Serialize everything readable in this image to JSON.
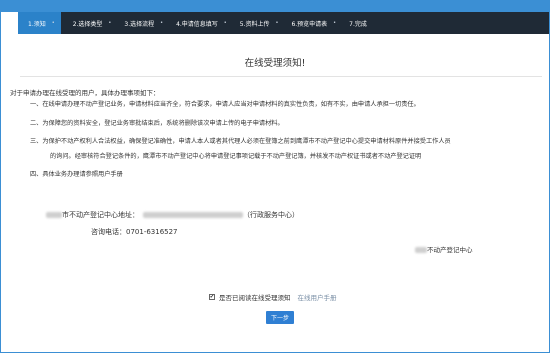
{
  "steps": [
    {
      "label": "1.须知"
    },
    {
      "label": "2.选择类型"
    },
    {
      "label": "3.选择流程"
    },
    {
      "label": "4.申请信息填写"
    },
    {
      "label": "5.资料上传"
    },
    {
      "label": "6.预览申请表"
    },
    {
      "label": "7.完成"
    }
  ],
  "step_separator": "•",
  "page_title": "在线受理须知!",
  "intro": "对于申请办理在线受理的用户，具体办理事项如下：",
  "notes": [
    "一、在线申请办理不动产登记业务，申请材料应当齐全，符合要求，申请人应当对申请材料的真实性负责，如有不实，由申请人承担一切责任。",
    "二、为保障您的资料安全，登记业务审批结束后，系统将删除该次申请上传的电子申请材料。",
    "三、为保护不动产权利人合法权益，确保登记准确性，申请人本人或者其代理人必须在登簿之前到鹰潭市不动产登记中心提交申请材料原件并接受工作人员",
    "的询问。经审核符合登记条件的，鹰潭市不动产登记中心将申请登记事项记载于不动产登记簿，并核发不动产权证书或者不动产登记证明",
    "四、具体业务办理请参照用户手册"
  ],
  "address_label": "市不动产登记中心地址：",
  "address_suffix": "（行政服务中心）",
  "phone_label": "咨询电话：",
  "phone": "0701-6316527",
  "org_name": "不动产登记中心",
  "agree_label": "是否已阅读在线受理须知",
  "checkbox_mark": "✔",
  "manual_link": "在线用户手册",
  "next_button": "下一步",
  "colors": {
    "accent": "#3b8fd4",
    "step_bar": "#1f2a36",
    "active_step": "#2b82c9",
    "button": "#2f7fd3"
  }
}
